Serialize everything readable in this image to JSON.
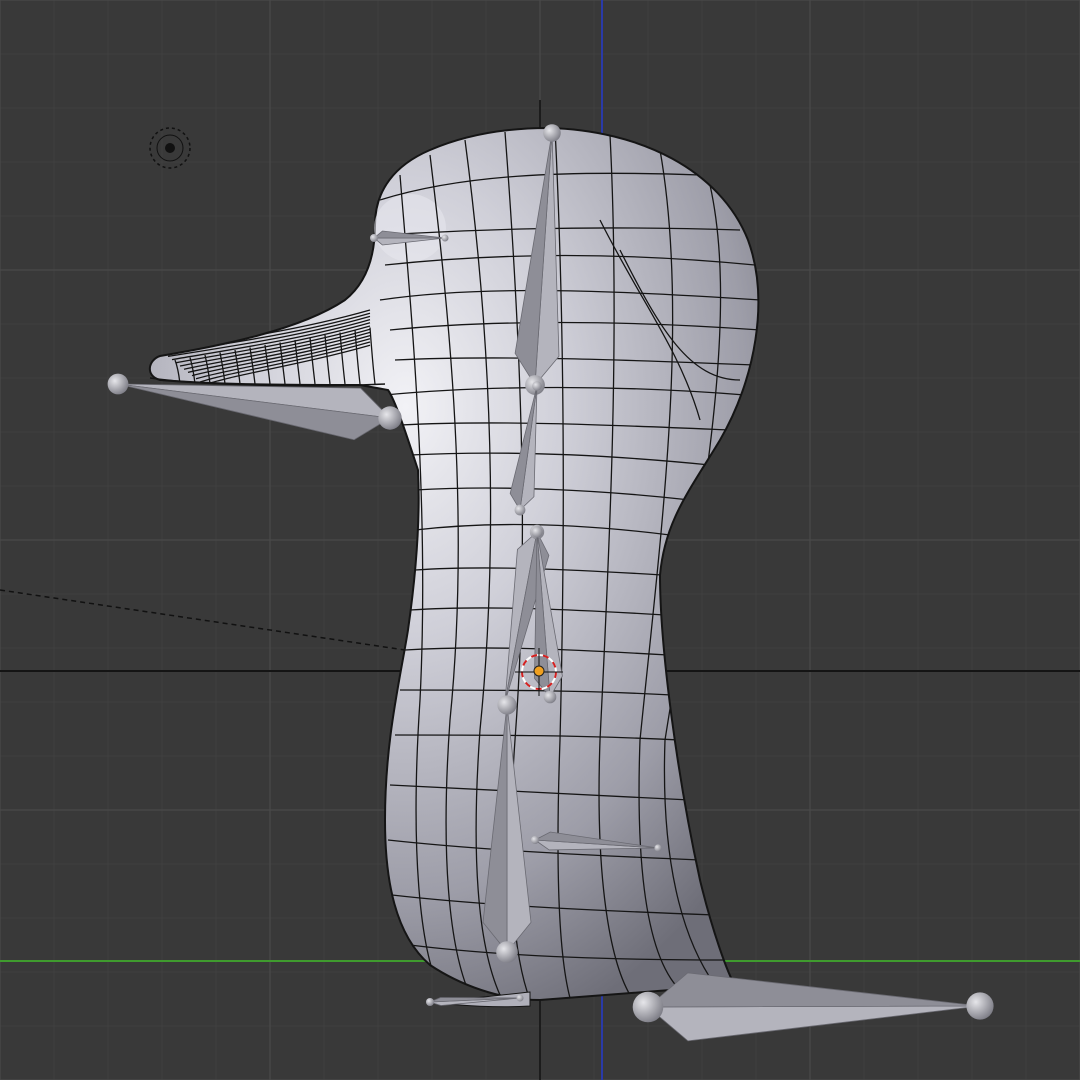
{
  "viewport": {
    "background": "#393939",
    "grid_minor_color": "#404040",
    "grid_major_color": "#4a4a4a",
    "axis_x_color": "#3f9b2e",
    "axis_z_color": "#2a3aa8",
    "horizon_color": "#141414",
    "mesh_color": "#b9b9c2",
    "wire_color": "#151515",
    "bone_color": "#a3a3ad"
  },
  "icons": [
    "lamp-icon",
    "3d-cursor-icon",
    "origin-dot-icon"
  ]
}
